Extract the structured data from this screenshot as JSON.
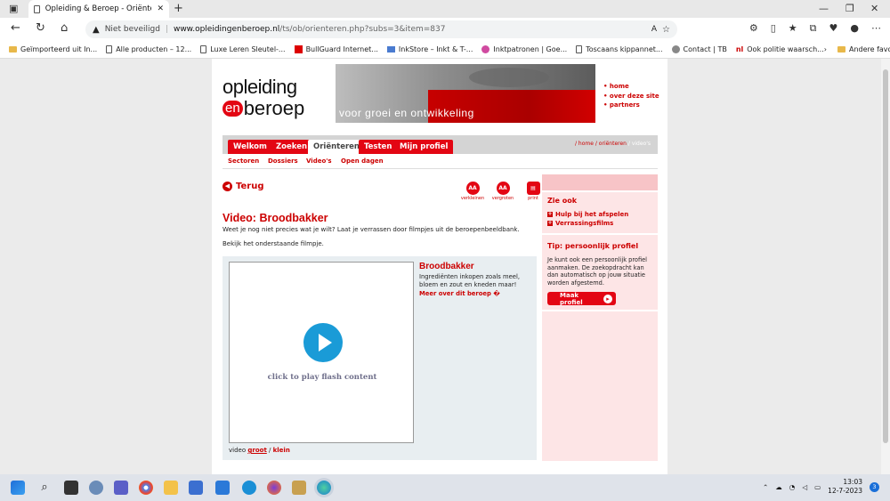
{
  "browser": {
    "tab_title": "Opleiding & Beroep - Oriënteren",
    "new_tab": "+",
    "security": "Niet beveiligd",
    "url_domain": "www.opleidingenberoep.nl",
    "url_path": "/ts/ob/orienteren.php?subs=3&item=837",
    "bookmarks": [
      {
        "label": "Geïmporteerd uit In...",
        "icon": "folder-icon"
      },
      {
        "label": "Alle producten – 12...",
        "icon": "page-icon"
      },
      {
        "label": "Luxe Leren Sleutel-...",
        "icon": "page-icon"
      },
      {
        "label": "BullGuard Internet...",
        "icon": "bullguard-icon"
      },
      {
        "label": "InkStore – Inkt & T-...",
        "icon": "inkstore-icon"
      },
      {
        "label": "Inktpatronen | Goe...",
        "icon": "ink-icon"
      },
      {
        "label": "Toscaans kippannet...",
        "icon": "page-icon"
      },
      {
        "label": "Contact | TB",
        "icon": "tb-icon"
      },
      {
        "label": "Ook politie waarsch...",
        "icon": "nl-icon"
      }
    ],
    "other_bookmarks": "Andere favorieten"
  },
  "site": {
    "logo_line1": "opleiding",
    "logo_en": "en",
    "logo_line2": "beroep",
    "banner_tagline": "voor groei en ontwikkeling",
    "top_links": [
      "home",
      "over deze site",
      "partners"
    ],
    "tabs": [
      {
        "label": "Welkom",
        "active": false
      },
      {
        "label": "Zoeken",
        "active": false
      },
      {
        "label": "Oriënteren",
        "active": true
      },
      {
        "label": "Testen",
        "active": false
      },
      {
        "label": "Mijn profiel",
        "active": false
      }
    ],
    "breadcrumb": {
      "home": "/ home",
      "orienteren": "/ oriënteren",
      "current": "/ video's"
    },
    "subnav": [
      "Sectoren",
      "Dossiers",
      "Video's",
      "Open dagen"
    ],
    "back": "Terug",
    "tools": [
      {
        "icon": "AA",
        "label": "verkleinen"
      },
      {
        "icon": "AA",
        "label": "vergroten"
      },
      {
        "icon": "print-icon",
        "label": "print"
      }
    ],
    "title": "Video: Broodbakker",
    "intro": "Weet je nog niet precies wat je wilt? Laat je verrassen door filmpjes uit de beroepenbeeldbank.",
    "instruction": "Bekijk het onderstaande filmpje.",
    "flash_text": "click to play flash content",
    "video_title": "Broodbakker",
    "video_desc": "Ingrediënten inkopen zoals meel, bloem en zout en kneden maar!",
    "video_more": "Meer over dit beroep �",
    "video_size_label": "video",
    "video_big": "groot",
    "video_sep": "/",
    "video_small": "klein",
    "sidebar": {
      "see_also_title": "Zie ook",
      "see_also": [
        "Hulp bij het afspelen",
        "Verrassingsfilms"
      ],
      "tip_title": "Tip: persoonlijk profiel",
      "tip_text": "Je kunt ook een persoonlijk profiel aanmaken. De zoekopdracht kan dan automatisch op jouw situatie worden afgestemd.",
      "tip_button": "Maak profiel"
    }
  },
  "taskbar": {
    "time": "13:03",
    "date": "12-7-2023",
    "notifications": "3"
  },
  "colors": {
    "brand_red": "#e30613",
    "flash_play": "#1a9bd7"
  }
}
